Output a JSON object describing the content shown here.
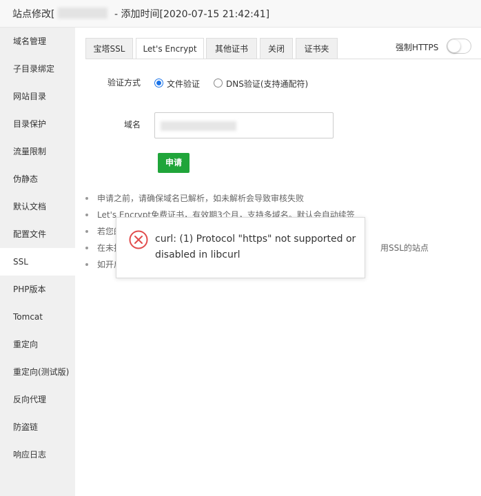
{
  "window": {
    "title_prefix": "站点修改[",
    "title_suffix": "- 添加时间[2020-07-15 21:42:41]"
  },
  "sidebar": {
    "items": [
      {
        "label": "域名管理"
      },
      {
        "label": "子目录绑定"
      },
      {
        "label": "网站目录"
      },
      {
        "label": "目录保护"
      },
      {
        "label": "流量限制"
      },
      {
        "label": "伪静态"
      },
      {
        "label": "默认文档"
      },
      {
        "label": "配置文件"
      },
      {
        "label": "SSL"
      },
      {
        "label": "PHP版本"
      },
      {
        "label": "Tomcat"
      },
      {
        "label": "重定向"
      },
      {
        "label": "重定向(测试版)"
      },
      {
        "label": "反向代理"
      },
      {
        "label": "防盗链"
      },
      {
        "label": "响应日志"
      }
    ],
    "active": "SSL"
  },
  "tabs": [
    {
      "label": "宝塔SSL"
    },
    {
      "label": "Let's Encrypt"
    },
    {
      "label": "其他证书"
    },
    {
      "label": "关闭"
    },
    {
      "label": "证书夹"
    }
  ],
  "active_tab": "Let's Encrypt",
  "force_https": {
    "label": "强制HTTPS",
    "enabled": false
  },
  "verify": {
    "label": "验证方式",
    "options": [
      {
        "label": "文件验证",
        "checked": true
      },
      {
        "label": "DNS验证(支持通配符)",
        "checked": false
      }
    ]
  },
  "domain": {
    "label": "域名"
  },
  "apply_button": "申请",
  "notes": [
    "申请之前，请确保域名已解析，如未解析会导致审核失败",
    "Let's Encrypt免费证书，有效期3个月，支持多域名。默认会自动续签",
    "若您的",
    "在未指",
    "如开启"
  ],
  "notes_tail": {
    "line4_tail": "用SSL的站点"
  },
  "toast": {
    "message": "curl: (1) Protocol \"https\" not supported or disabled in libcurl"
  },
  "colors": {
    "accent_green": "#20a53a",
    "radio_blue": "#1a73e8",
    "error_red": "#e14b4b"
  }
}
